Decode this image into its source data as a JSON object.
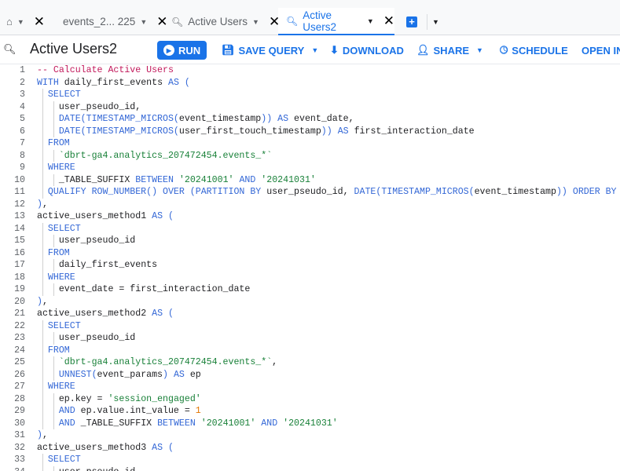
{
  "tabs": [
    {
      "label": "",
      "icon": "home-icon"
    },
    {
      "label": "events_2... 225"
    },
    {
      "label": "Active Users",
      "icon": "query-icon"
    },
    {
      "label": "Active Users2",
      "icon": "query-icon",
      "active": true
    }
  ],
  "toolbar": {
    "title": "Active Users2",
    "run": "RUN",
    "save_query": "SAVE QUERY",
    "download": "DOWNLOAD",
    "share": "SHARE",
    "schedule": "SCHEDULE",
    "open_in": "OPEN IN"
  },
  "colors": {
    "accent": "#1a73e8",
    "keyword": "#3367d6",
    "string": "#188038",
    "comment": "#c2185b",
    "number": "#e37400"
  },
  "code": [
    {
      "i": 0,
      "t": [
        [
          "c",
          "-- Calculate Active Users"
        ]
      ]
    },
    {
      "i": 0,
      "t": [
        [
          "k",
          "WITH"
        ],
        [
          "p",
          " daily_first_events "
        ],
        [
          "k",
          "AS ("
        ]
      ]
    },
    {
      "i": 1,
      "t": [
        [
          "k",
          "SELECT"
        ]
      ]
    },
    {
      "i": 2,
      "t": [
        [
          "p",
          "user_pseudo_id,"
        ]
      ]
    },
    {
      "i": 2,
      "t": [
        [
          "k",
          "DATE(TIMESTAMP_MICROS("
        ],
        [
          "p",
          "event_timestamp"
        ],
        [
          "k",
          "))"
        ],
        [
          "p",
          " "
        ],
        [
          "k",
          "AS"
        ],
        [
          "p",
          " event_date,"
        ]
      ]
    },
    {
      "i": 2,
      "t": [
        [
          "k",
          "DATE(TIMESTAMP_MICROS("
        ],
        [
          "p",
          "user_first_touch_timestamp"
        ],
        [
          "k",
          "))"
        ],
        [
          "p",
          " "
        ],
        [
          "k",
          "AS"
        ],
        [
          "p",
          " first_interaction_date"
        ]
      ]
    },
    {
      "i": 1,
      "t": [
        [
          "k",
          "FROM"
        ]
      ]
    },
    {
      "i": 2,
      "t": [
        [
          "s",
          "`dbrt-ga4.analytics_207472454.events_*`"
        ]
      ]
    },
    {
      "i": 1,
      "t": [
        [
          "k",
          "WHERE"
        ]
      ]
    },
    {
      "i": 2,
      "t": [
        [
          "p",
          "_TABLE_SUFFIX "
        ],
        [
          "k",
          "BETWEEN"
        ],
        [
          "p",
          " "
        ],
        [
          "s",
          "'20241001'"
        ],
        [
          "p",
          " "
        ],
        [
          "k",
          "AND"
        ],
        [
          "p",
          " "
        ],
        [
          "s",
          "'20241031'"
        ]
      ]
    },
    {
      "i": 1,
      "t": [
        [
          "k",
          "QUALIFY ROW_NUMBER() OVER (PARTITION BY"
        ],
        [
          "p",
          " user_pseudo_id, "
        ],
        [
          "k",
          "DATE(TIMESTAMP_MICROS("
        ],
        [
          "p",
          "event_timestamp"
        ],
        [
          "k",
          "))"
        ],
        [
          "p",
          " "
        ],
        [
          "k",
          "ORDER BY"
        ]
      ]
    },
    {
      "i": 0,
      "t": [
        [
          "k",
          ")"
        ],
        [
          "p",
          ","
        ]
      ]
    },
    {
      "i": 0,
      "t": [
        [
          "p",
          "active_users_method1 "
        ],
        [
          "k",
          "AS ("
        ]
      ]
    },
    {
      "i": 1,
      "t": [
        [
          "k",
          "SELECT"
        ]
      ]
    },
    {
      "i": 2,
      "t": [
        [
          "p",
          "user_pseudo_id"
        ]
      ]
    },
    {
      "i": 1,
      "t": [
        [
          "k",
          "FROM"
        ]
      ]
    },
    {
      "i": 2,
      "t": [
        [
          "p",
          "daily_first_events"
        ]
      ]
    },
    {
      "i": 1,
      "t": [
        [
          "k",
          "WHERE"
        ]
      ]
    },
    {
      "i": 2,
      "t": [
        [
          "p",
          "event_date = first_interaction_date"
        ]
      ]
    },
    {
      "i": 0,
      "t": [
        [
          "k",
          ")"
        ],
        [
          "p",
          ","
        ]
      ]
    },
    {
      "i": 0,
      "t": [
        [
          "p",
          "active_users_method2 "
        ],
        [
          "k",
          "AS ("
        ]
      ]
    },
    {
      "i": 1,
      "t": [
        [
          "k",
          "SELECT"
        ]
      ]
    },
    {
      "i": 2,
      "t": [
        [
          "p",
          "user_pseudo_id"
        ]
      ]
    },
    {
      "i": 1,
      "t": [
        [
          "k",
          "FROM"
        ]
      ]
    },
    {
      "i": 2,
      "t": [
        [
          "s",
          "`dbrt-ga4.analytics_207472454.events_*`"
        ],
        [
          "p",
          ","
        ]
      ]
    },
    {
      "i": 2,
      "t": [
        [
          "k",
          "UNNEST("
        ],
        [
          "p",
          "event_params"
        ],
        [
          "k",
          ")"
        ],
        [
          "p",
          " "
        ],
        [
          "k",
          "AS"
        ],
        [
          "p",
          " ep"
        ]
      ]
    },
    {
      "i": 1,
      "t": [
        [
          "k",
          "WHERE"
        ]
      ]
    },
    {
      "i": 2,
      "t": [
        [
          "p",
          "ep.key = "
        ],
        [
          "s",
          "'session_engaged'"
        ]
      ]
    },
    {
      "i": 2,
      "t": [
        [
          "k",
          "AND"
        ],
        [
          "p",
          " ep.value.int_value = "
        ],
        [
          "n",
          "1"
        ]
      ]
    },
    {
      "i": 2,
      "t": [
        [
          "k",
          "AND"
        ],
        [
          "p",
          " _TABLE_SUFFIX "
        ],
        [
          "k",
          "BETWEEN"
        ],
        [
          "p",
          " "
        ],
        [
          "s",
          "'20241001'"
        ],
        [
          "p",
          " "
        ],
        [
          "k",
          "AND"
        ],
        [
          "p",
          " "
        ],
        [
          "s",
          "'20241031'"
        ]
      ]
    },
    {
      "i": 0,
      "t": [
        [
          "k",
          ")"
        ],
        [
          "p",
          ","
        ]
      ]
    },
    {
      "i": 0,
      "t": [
        [
          "p",
          "active_users_method3 "
        ],
        [
          "k",
          "AS ("
        ]
      ]
    },
    {
      "i": 1,
      "t": [
        [
          "k",
          "SELECT"
        ]
      ]
    },
    {
      "i": 2,
      "t": [
        [
          "p",
          "user_pseudo_id"
        ]
      ]
    }
  ]
}
